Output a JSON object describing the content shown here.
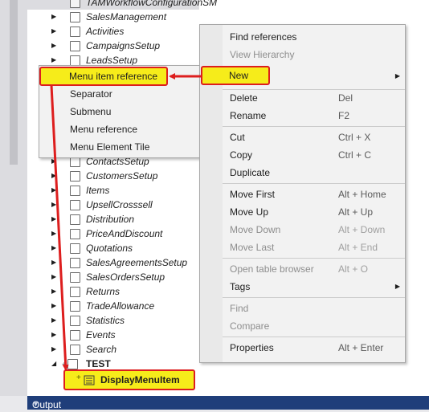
{
  "tree": {
    "top_item": "TAMWorkflowConfigurationSM",
    "upper_items": [
      "SalesManagement",
      "Activities",
      "CampaignsSetup",
      "LeadsSetup"
    ],
    "lower_items": [
      "ContactsSetup",
      "CustomersSetup",
      "Items",
      "UpsellCrosssell",
      "Distribution",
      "PriceAndDiscount",
      "Quotations",
      "SalesAgreementsSetup",
      "SalesOrdersSetup",
      "Returns",
      "TradeAllowance",
      "Statistics",
      "Events",
      "Search"
    ],
    "test_node": "TEST",
    "child_node": "DisplayMenuItem"
  },
  "submenu": {
    "items": [
      "Menu item reference",
      "Separator",
      "Submenu",
      "Menu reference",
      "Menu Element Tile"
    ]
  },
  "context_menu": {
    "find_references": "Find references",
    "view_hierarchy": "View Hierarchy",
    "new": "New",
    "delete": "Delete",
    "delete_sc": "Del",
    "rename": "Rename",
    "rename_sc": "F2",
    "cut": "Cut",
    "cut_sc": "Ctrl + X",
    "copy": "Copy",
    "copy_sc": "Ctrl + C",
    "duplicate": "Duplicate",
    "move_first": "Move First",
    "move_first_sc": "Alt + Home",
    "move_up": "Move Up",
    "move_up_sc": "Alt + Up",
    "move_down": "Move Down",
    "move_down_sc": "Alt + Down",
    "move_last": "Move Last",
    "move_last_sc": "Alt + End",
    "open_table_browser": "Open table browser",
    "open_table_browser_sc": "Alt + O",
    "tags": "Tags",
    "find": "Find",
    "compare": "Compare",
    "properties": "Properties",
    "properties_sc": "Alt + Enter"
  },
  "output_panel": {
    "title": "Output"
  },
  "colors": {
    "highlight": "#f6ec1a",
    "annotation": "#dd1e1e",
    "output_bar": "#1f3e7a"
  }
}
